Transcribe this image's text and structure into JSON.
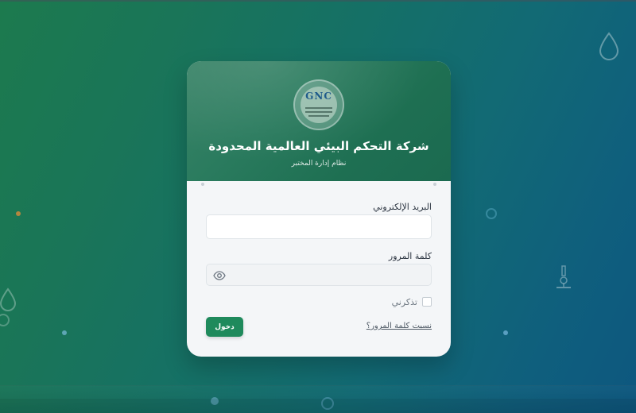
{
  "header": {
    "company_name": "شركة التحكم البيئي العالمية المحدودة",
    "system_name": "نظام إدارة المختبر",
    "logo_letters": "GNC"
  },
  "form": {
    "email_label": "البريد الإلكتروني",
    "email_value": "",
    "password_label": "كلمة المرور",
    "password_value": "",
    "remember_label": "تذكرني",
    "remember_checked": false,
    "forgot_link": "نسيت كلمة المرور؟",
    "login_button": "دخول"
  },
  "colors": {
    "primary": "#1f8a5c",
    "header_green": "#2a7b5e",
    "bg_start": "#1c7a4e",
    "bg_end": "#0d577f"
  },
  "icons": {
    "password_toggle": "eye-icon",
    "decor": [
      "water-drop-icon",
      "microscope-icon",
      "flask-icon"
    ]
  }
}
